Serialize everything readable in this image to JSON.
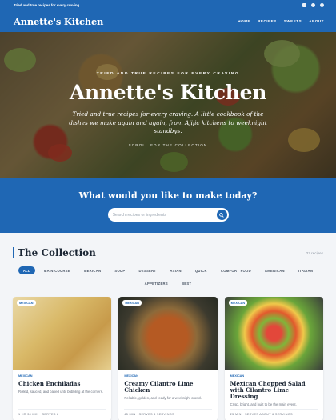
{
  "topbar": {
    "tagline": "Tried and true recipes for every craving."
  },
  "nav": {
    "brand": "Annette's Kitchen",
    "links": [
      "HOME",
      "RECIPES",
      "SWEETS",
      "ABOUT"
    ]
  },
  "hero": {
    "kicker": "TRIED AND TRUE RECIPES FOR EVERY CRAVING",
    "title": "Annette's Kitchen",
    "subtitle": "Tried and true recipes for every craving. A little cookbook of the dishes we make again and again, from Ajijic kitchens to weeknight standbys.",
    "scroll": "SCROLL FOR THE COLLECTION"
  },
  "search": {
    "heading": "What would you like to make today?",
    "placeholder": "Search recipes or ingredients"
  },
  "collection": {
    "title": "The Collection",
    "count": "27 recipes",
    "chips": [
      "ALL",
      "MAIN COURSE",
      "MEXICAN",
      "SOUP",
      "DESSERT",
      "ASIAN",
      "QUICK",
      "COMFORT FOOD",
      "AMERICAN",
      "ITALIAN",
      "APPETIZERS",
      "BEST"
    ]
  },
  "cards": [
    {
      "tag": "MEXICAN",
      "category": "MEXICAN",
      "name": "Chicken Enchiladas",
      "desc": "Rolled, sauced, and baked until bubbling at the corners.",
      "meta": "1 HR 30 MIN · SERVES 8"
    },
    {
      "tag": "MEXICAN",
      "category": "MEXICAN",
      "name": "Creamy Cilantro Lime Chicken",
      "desc": "Reliable, golden, and ready for a weeknight crowd.",
      "meta": "45 MIN · SERVES 4 SERVINGS"
    },
    {
      "tag": "MEXICAN",
      "category": "MEXICAN",
      "name": "Mexican Chopped Salad with Cilantro Lime Dressing",
      "desc": "Crisp, bright, and built to be the main event.",
      "meta": "25 MIN · SERVES ABOUT 6 SERVINGS"
    }
  ],
  "colors": {
    "brand": "#1f67b4",
    "background": "#f3f5f8"
  },
  "icons": [
    "mail-icon",
    "pinterest-icon",
    "facebook-icon",
    "search-icon"
  ]
}
